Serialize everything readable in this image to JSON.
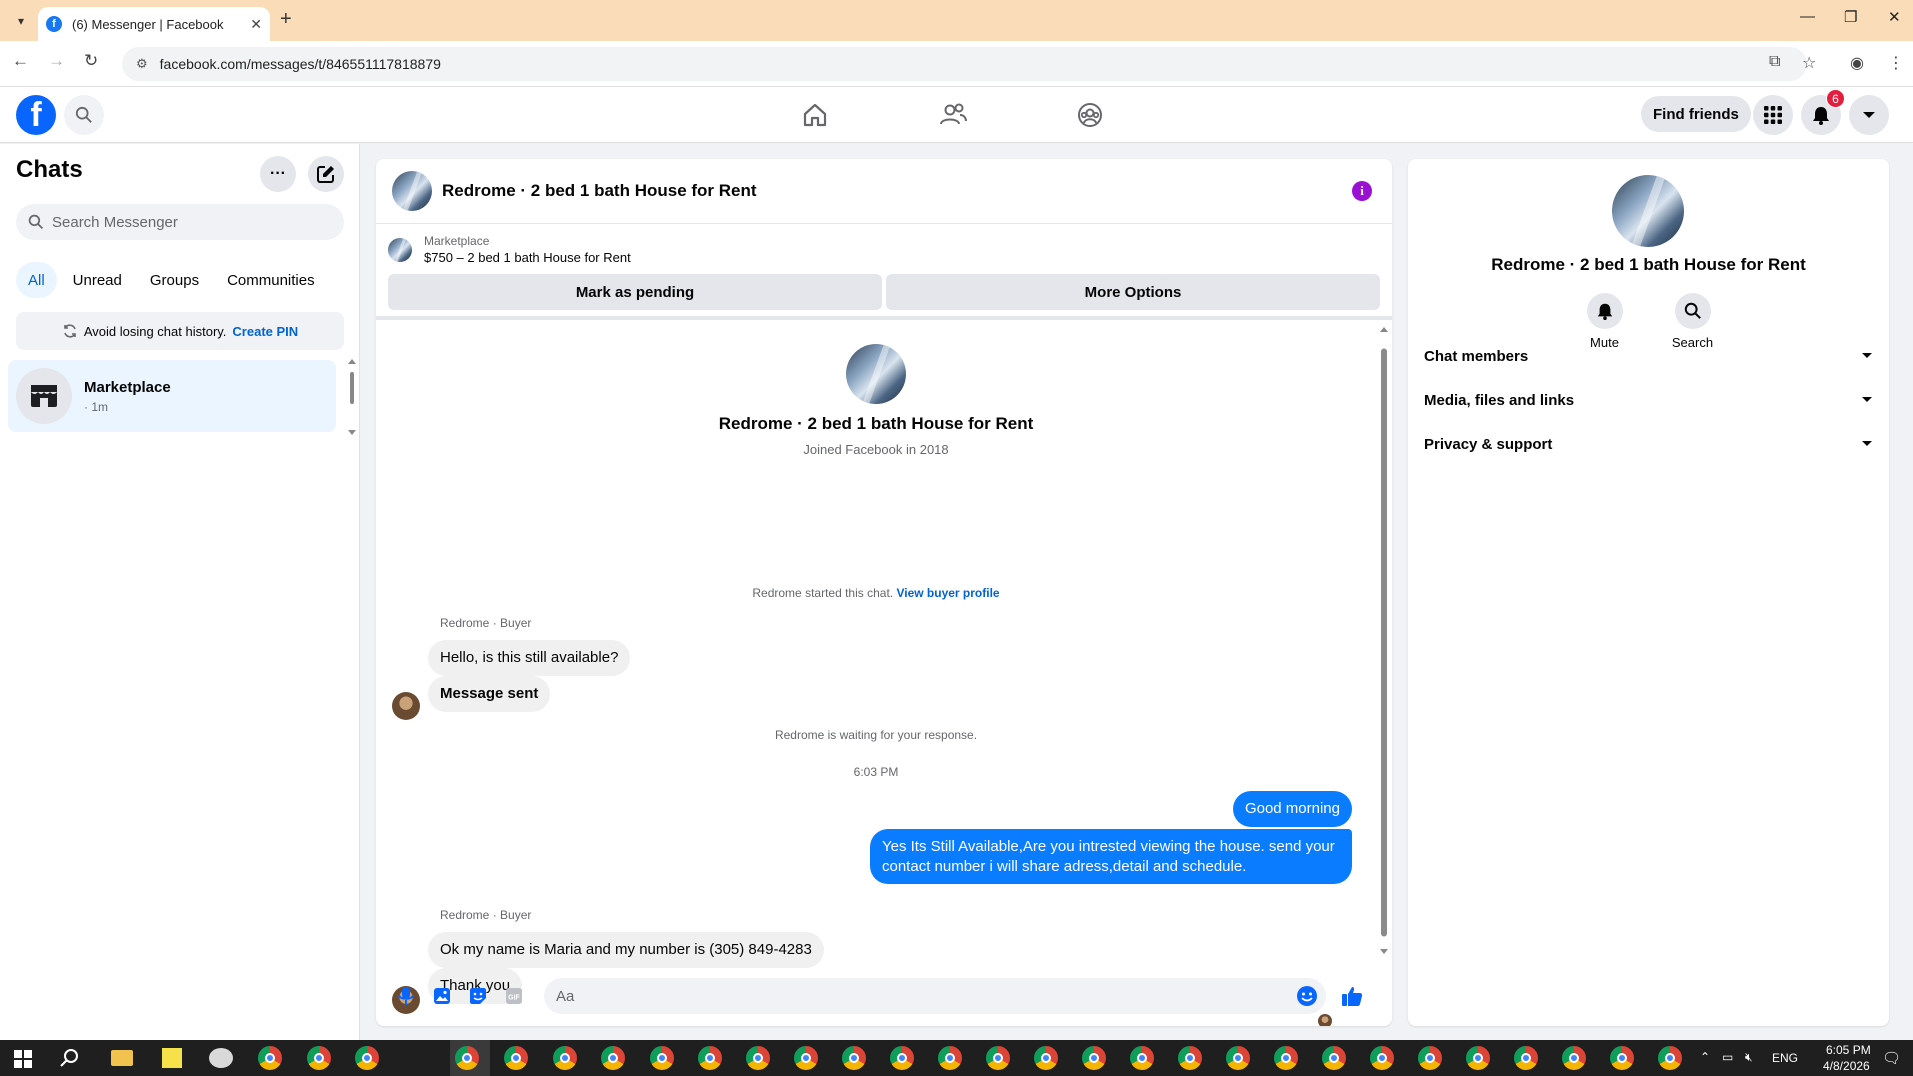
{
  "browser": {
    "tab_title": "(6) Messenger | Facebook",
    "url": "facebook.com/messages/t/846551117818879"
  },
  "header": {
    "find_friends": "Find friends",
    "notification_count": "6"
  },
  "sidebar": {
    "title": "Chats",
    "search_placeholder": "Search Messenger",
    "filters": [
      "All",
      "Unread",
      "Groups",
      "Communities"
    ],
    "pin_banner_text": "Avoid losing chat history.",
    "pin_banner_link": "Create PIN",
    "chats": [
      {
        "name": "Marketplace",
        "time": "· 1m"
      }
    ]
  },
  "conversation": {
    "title": "Redrome · 2 bed 1 bath House for Rent",
    "marketplace_label": "Marketplace",
    "listing": "$750 – 2 bed 1 bath House for Rent",
    "mark_pending": "Mark as pending",
    "more_options": "More Options",
    "intro_name": "Redrome · 2 bed 1 bath House for Rent",
    "joined": "Joined Facebook in 2018",
    "started_text": "Redrome started this chat.",
    "view_buyer_profile": "View buyer profile",
    "sender_label": "Redrome · Buyer",
    "msg1": "Hello, is this still available?",
    "msg2": "Message sent",
    "waiting": "Redrome is waiting for your response.",
    "timestamp": "6:03 PM",
    "out1": "Good morning",
    "out2": "Yes Its Still Available,Are you intrested viewing the house. send your contact number i will share adress,detail and schedule.",
    "sender_label2": "Redrome · Buyer",
    "msg3": "Ok my name is Maria and my number is (305) 849-4283",
    "msg4": "Thank you",
    "composer_placeholder": "Aa"
  },
  "right_panel": {
    "name": "Redrome · 2 bed 1 bath House for Rent",
    "mute": "Mute",
    "search": "Search",
    "sections": [
      "Chat members",
      "Media, files and links",
      "Privacy & support"
    ]
  },
  "taskbar": {
    "lang": "ENG",
    "time": "6:05 PM",
    "date": "4/8/2026"
  },
  "colors": {
    "brand_blue": "#0866ff",
    "outgoing_bubble": "#0a7cff",
    "info_purple": "#9b11d4",
    "tabbar": "#fbdcb9"
  }
}
